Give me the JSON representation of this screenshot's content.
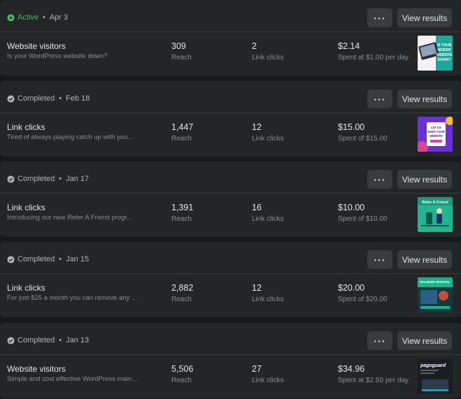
{
  "buttons": {
    "more_label": "···",
    "view_label": "View results"
  },
  "colors": {
    "active": "#45bd62",
    "completed": "#b0b3b8"
  },
  "campaigns": [
    {
      "status": "Active",
      "status_icon": "play-circle-icon",
      "date": "Apr 3",
      "objective": "Website visitors",
      "description": "Is your WordPress website down?",
      "reach": "309",
      "reach_label": "Reach",
      "results": "2",
      "results_label": "Link clicks",
      "spend": "$2.14",
      "spend_label": "Spent at $1.00 per day",
      "thumb_text": "IS YOUR WORDP WEBSITE DOWN?"
    },
    {
      "status": "Completed",
      "status_icon": "check-circle-icon",
      "date": "Feb 18",
      "objective": "Link clicks",
      "description": "Tired of always playing catch up with you...",
      "reach": "1,447",
      "reach_label": "Reach",
      "results": "12",
      "results_label": "Link clicks",
      "spend": "$15.00",
      "spend_label": "Spent of $15.00",
      "thumb_text": "LET US KEEP YOUR WEBSITE"
    },
    {
      "status": "Completed",
      "status_icon": "check-circle-icon",
      "date": "Jan 17",
      "objective": "Link clicks",
      "description": "Introducing our new Refer A Friend progr...",
      "reach": "1,391",
      "reach_label": "Reach",
      "results": "16",
      "results_label": "Link clicks",
      "spend": "$10.00",
      "spend_label": "Spent of $10.00",
      "thumb_text": "Refer A Friend"
    },
    {
      "status": "Completed",
      "status_icon": "check-circle-icon",
      "date": "Jan 15",
      "objective": "Link clicks",
      "description": "For just $25 a month you can remove any ...",
      "reach": "2,882",
      "reach_label": "Reach",
      "results": "12",
      "results_label": "Link clicks",
      "spend": "$20.00",
      "spend_label": "Spent of $20.00",
      "thumb_text": "MALWARE REMOVAL"
    },
    {
      "status": "Completed",
      "status_icon": "check-circle-icon",
      "date": "Jan 13",
      "objective": "Website visitors",
      "description": "Simple and cost effective WordPress main...",
      "reach": "5,506",
      "reach_label": "Reach",
      "results": "27",
      "results_label": "Link clicks",
      "spend": "$34.96",
      "spend_label": "Spent at $2.50 per day",
      "thumb_text": "pagoguard"
    }
  ]
}
